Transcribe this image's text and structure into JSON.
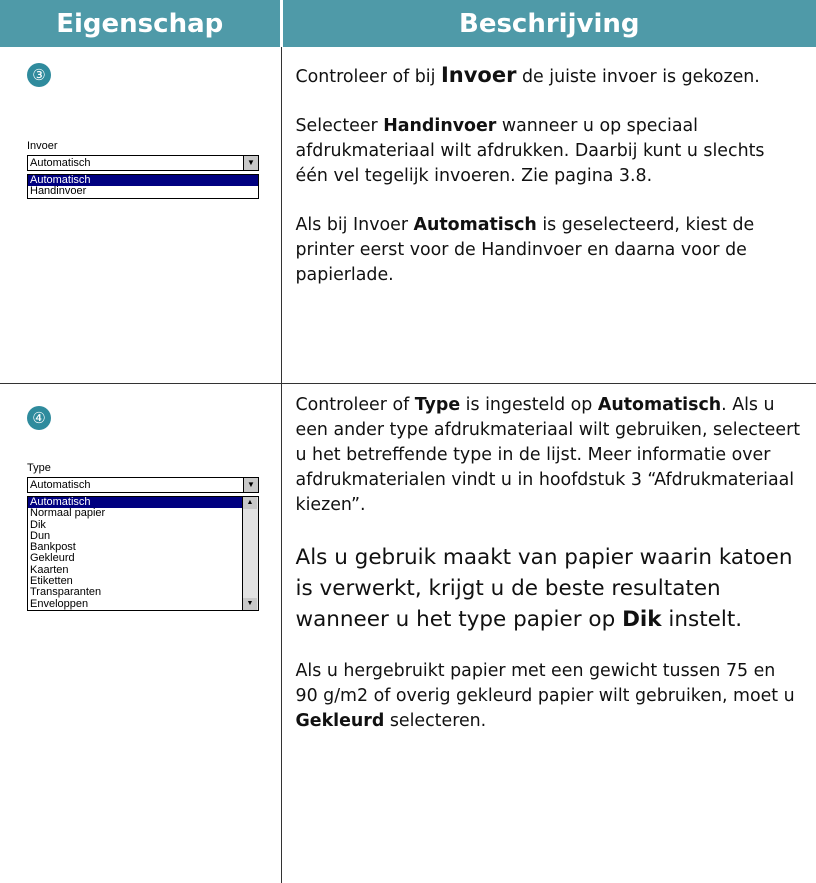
{
  "header": {
    "col1": "Eigenschap",
    "col2": "Beschrijving"
  },
  "row1": {
    "marker": "③",
    "widget": {
      "label": "Invoer",
      "value": "Automatisch",
      "options": [
        "Automatisch",
        "Handinvoer"
      ],
      "selected_index": 0
    },
    "p1": {
      "pre": "Controleer of bij ",
      "bold": "Invoer",
      "post": " de juiste invoer is gekozen."
    },
    "p2": {
      "pre": "Selecteer ",
      "bold": "Handinvoer",
      "post": " wanneer u op speciaal afdrukmateriaal wilt afdrukken. Daarbij kunt u slechts één vel tegelijk invoeren. Zie pagina 3.8."
    },
    "p3": {
      "pre": "Als bij Invoer ",
      "bold": "Automatisch",
      "post": " is geselecteerd, kiest de printer eerst voor de Handinvoer en daarna voor de papierlade."
    }
  },
  "row2": {
    "marker": "④",
    "widget": {
      "label": "Type",
      "value": "Automatisch",
      "options": [
        "Automatisch",
        "Normaal papier",
        "Dik",
        "Dun",
        "Bankpost",
        "Gekleurd",
        "Kaarten",
        "Etiketten",
        "Transparanten",
        "Enveloppen"
      ],
      "selected_index": 0
    },
    "p1": {
      "pre": "Controleer of ",
      "bold1": "Type",
      "mid": " is ingesteld op ",
      "bold2": "Automatisch",
      "post": ". Als u een ander type afdrukmateriaal wilt gebruiken, selecteert u het betreffende type in de lijst. Meer informatie over afdrukmaterialen vindt u in hoofdstuk 3 “Afdrukmateriaal kiezen”."
    },
    "p2": {
      "pre": "Als u gebruik maakt van papier waarin katoen is verwerkt, krijgt u de beste resultaten wanneer u het type papier op ",
      "bold": "Dik",
      "post": " instelt."
    },
    "p3": {
      "pre": "Als u hergebruikt papier met een gewicht tussen 75 en 90 g/m2 of overig gekleurd papier wilt gebruiken, moet u ",
      "bold": "Gekleurd",
      "post": " selecteren."
    }
  }
}
